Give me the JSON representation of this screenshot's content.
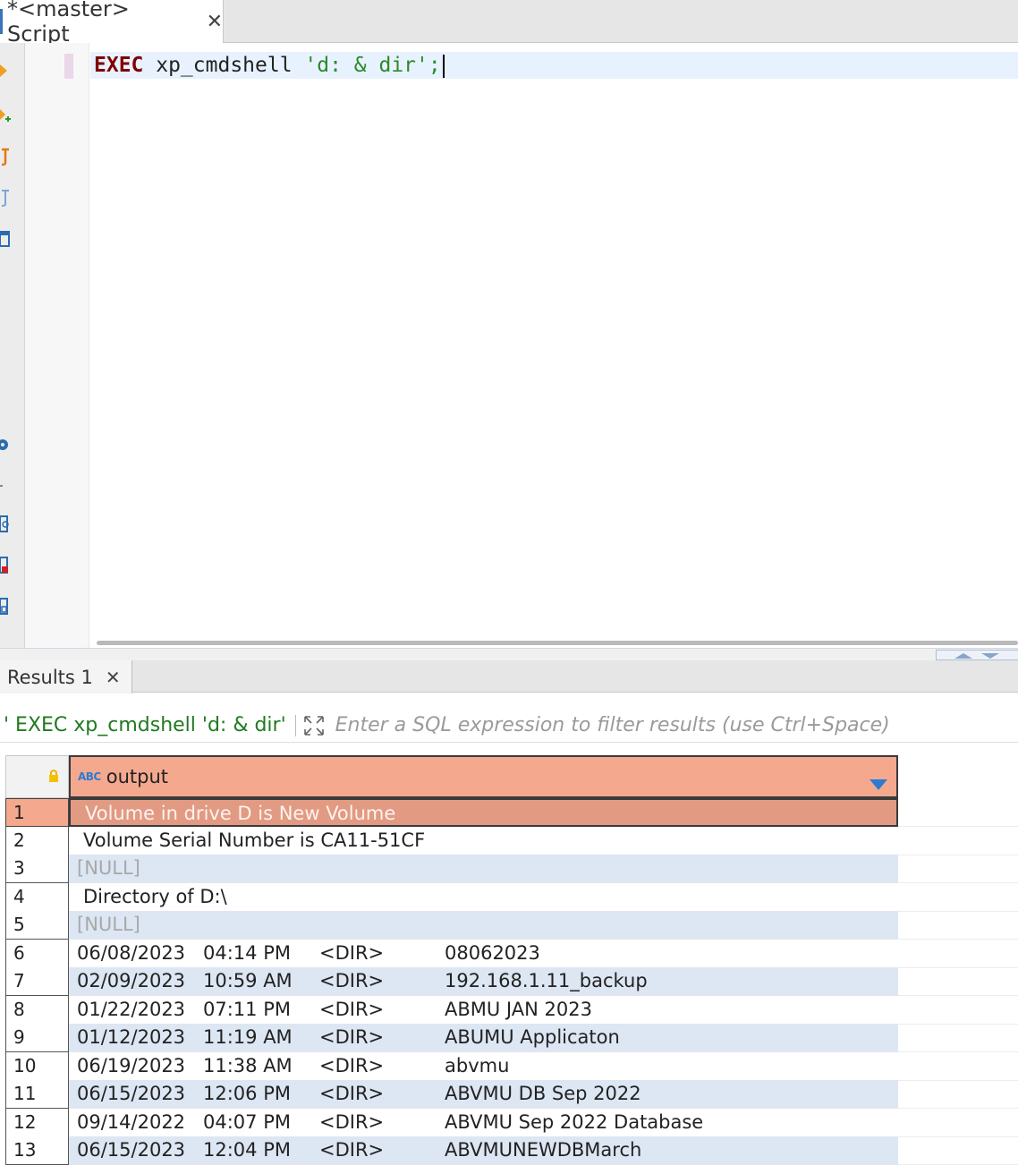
{
  "editor_tab": {
    "title": "*<master> Script",
    "close": "✕"
  },
  "editor": {
    "code": {
      "keyword": "EXEC",
      "proc": " xp_cmdshell ",
      "string": "'d: & dir'",
      "terminator": ";"
    }
  },
  "results_tab": {
    "title": "Results 1",
    "close": "✕"
  },
  "filter": {
    "query": "' EXEC xp_cmdshell 'd: & dir'",
    "placeholder": "Enter a SQL expression to filter results (use Ctrl+Space)"
  },
  "grid": {
    "type_badge": "ABC",
    "column": "output",
    "rows": [
      {
        "n": "1",
        "type": "text",
        "text": "Volume in drive D is New Volume"
      },
      {
        "n": "2",
        "type": "text",
        "text": "Volume Serial Number is CA11-51CF"
      },
      {
        "n": "3",
        "type": "null",
        "text": "[NULL]"
      },
      {
        "n": "4",
        "type": "text",
        "text": "Directory of D:\\"
      },
      {
        "n": "5",
        "type": "null",
        "text": "[NULL]"
      },
      {
        "n": "6",
        "type": "dir",
        "date": "06/08/2023",
        "time": "04:14 PM",
        "tag": "<DIR>",
        "name": "08062023"
      },
      {
        "n": "7",
        "type": "dir",
        "date": "02/09/2023",
        "time": "10:59 AM",
        "tag": "<DIR>",
        "name": "192.168.1.11_backup"
      },
      {
        "n": "8",
        "type": "dir",
        "date": "01/22/2023",
        "time": "07:11 PM",
        "tag": "<DIR>",
        "name": "ABMU JAN 2023"
      },
      {
        "n": "9",
        "type": "dir",
        "date": "01/12/2023",
        "time": "11:19 AM",
        "tag": "<DIR>",
        "name": "ABUMU Applicaton"
      },
      {
        "n": "10",
        "type": "dir",
        "date": "06/19/2023",
        "time": "11:38 AM",
        "tag": "<DIR>",
        "name": "abvmu"
      },
      {
        "n": "11",
        "type": "dir",
        "date": "06/15/2023",
        "time": "12:06 PM",
        "tag": "<DIR>",
        "name": "ABVMU DB Sep 2022"
      },
      {
        "n": "12",
        "type": "dir",
        "date": "09/14/2022",
        "time": "04:07 PM",
        "tag": "<DIR>",
        "name": "ABVMU Sep 2022 Database"
      },
      {
        "n": "13",
        "type": "dir",
        "date": "06/15/2023",
        "time": "12:04 PM",
        "tag": "<DIR>",
        "name": "ABVMUNEWDBMarch"
      }
    ]
  },
  "colors": {
    "header_accent": "#f4a98f",
    "selected_row": "#e29a83",
    "alt_row": "#dde6f3",
    "keyword": "#7f0000",
    "string": "#2a8a2a"
  }
}
